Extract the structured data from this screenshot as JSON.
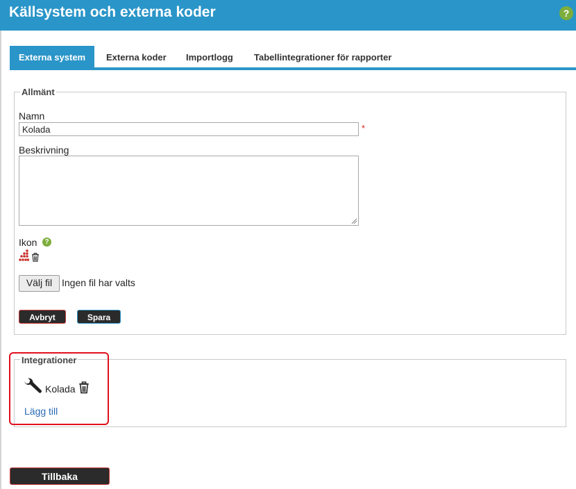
{
  "header": {
    "title": "Källsystem och externa koder",
    "help": "?"
  },
  "tabs": [
    {
      "label": "Externa system",
      "active": true
    },
    {
      "label": "Externa koder"
    },
    {
      "label": "Importlogg"
    },
    {
      "label": "Tabellintegrationer för rapporter"
    }
  ],
  "general": {
    "legend": "Allmänt",
    "name_label": "Namn",
    "name_value": "Kolada",
    "required_mark": "*",
    "description_label": "Beskrivning",
    "description_value": "",
    "icon_label": "Ikon",
    "icon_help": "?",
    "file_button": "Välj fil",
    "file_status": "Ingen fil har valts",
    "cancel_button": "Avbryt",
    "save_button": "Spara"
  },
  "integrations": {
    "legend": "Integrationer",
    "items": [
      {
        "name": "Kolada"
      }
    ],
    "add_link": "Lägg till"
  },
  "back_button": "Tillbaka",
  "colors": {
    "accent": "#2a95c8",
    "help_green": "#7dad3c",
    "button_dark": "#2b2b2b",
    "required": "#d22222",
    "highlight": "#e0101c",
    "link": "#2a6ab5"
  }
}
